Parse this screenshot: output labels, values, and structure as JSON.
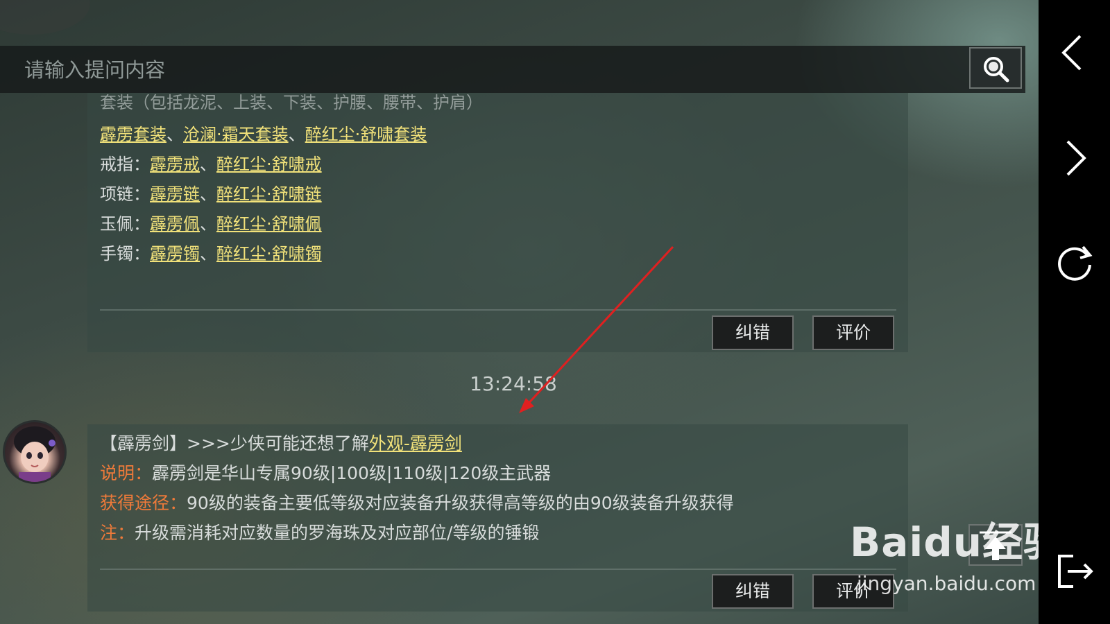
{
  "search": {
    "placeholder": "请输入提问内容"
  },
  "card1": {
    "truncated_line": "套装（包括龙泥、上装、下装、护腰、腰带、护肩）",
    "sets": [
      "霹雳套装",
      "沧澜·霜天套装",
      "醉红尘·舒啸套装"
    ],
    "rows": [
      {
        "label": "戒指：",
        "items": [
          "霹雳戒",
          "醉红尘·舒啸戒"
        ]
      },
      {
        "label": "项链：",
        "items": [
          "霹雳链",
          "醉红尘·舒啸链"
        ]
      },
      {
        "label": "玉佩：",
        "items": [
          "霹雳佩",
          "醉红尘·舒啸佩"
        ]
      },
      {
        "label": "手镯：",
        "items": [
          "霹雳镯",
          "醉红尘·舒啸镯"
        ]
      }
    ],
    "separator": "、",
    "correct_button": "纠错",
    "rate_button": "评价"
  },
  "timestamp": "13:24:58",
  "card2": {
    "intro_prefix": "【霹雳剑】>>>少侠可能还想了解",
    "intro_link": "外观-霹雳剑",
    "desc_label": "说明：",
    "desc_text": "霹雳剑是华山专属90级|100级|110级|120级主武器",
    "source_label": "获得途径：",
    "source_text": "90级的装备主要低等级对应装备升级获得高等级的由90级装备升级获得",
    "note_label": "注：",
    "note_text": "升级需消耗对应数量的罗海珠及对应部位/等级的锤锻",
    "correct_button": "纠错",
    "rate_button": "评价"
  },
  "watermark": {
    "brand": "Baidu经验",
    "url": "jingyan.baidu.com"
  },
  "icons": {
    "search": "search-icon",
    "back": "chevron-left-icon",
    "forward": "chevron-right-icon",
    "refresh": "refresh-icon",
    "exit": "exit-icon",
    "scroll_top": "arrow-up-icon"
  },
  "colors": {
    "link": "#f2e27a",
    "label_orange": "#ee7a3a",
    "annotation_arrow": "#e02020"
  }
}
